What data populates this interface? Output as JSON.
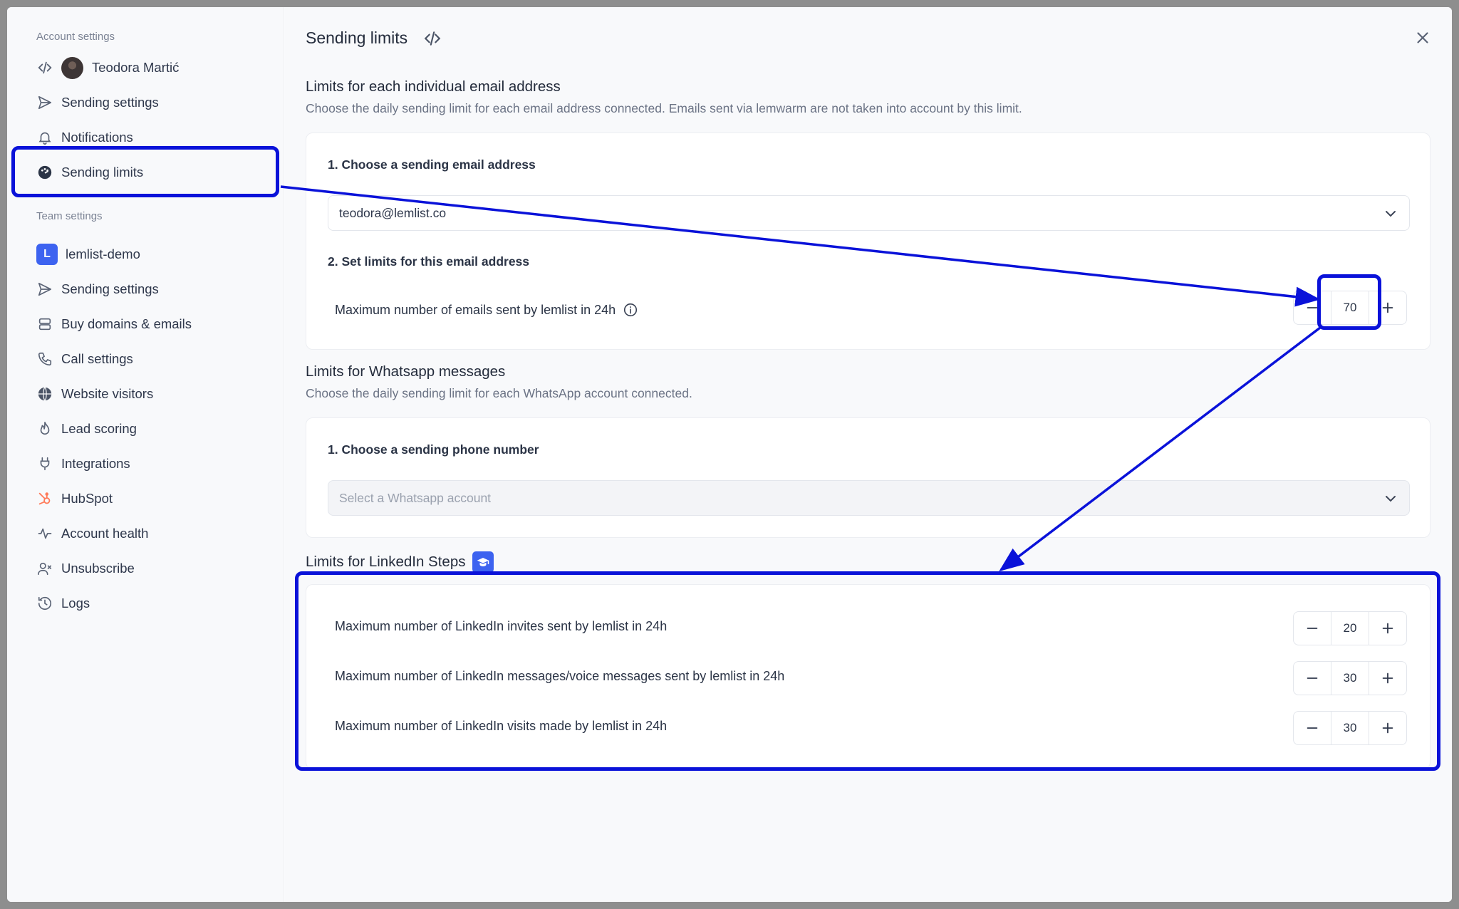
{
  "sidebar": {
    "account_heading": "Account settings",
    "team_heading": "Team settings",
    "account_items": [
      {
        "label": "Teodora Martić",
        "icon": "code-icon"
      },
      {
        "label": "Sending settings",
        "icon": "send-icon"
      },
      {
        "label": "Notifications",
        "icon": "bell-icon"
      },
      {
        "label": "Sending limits",
        "icon": "gauge-icon",
        "active": true
      }
    ],
    "team_items": [
      {
        "label": "lemlist-demo",
        "icon": "team-logo-icon"
      },
      {
        "label": "Sending settings",
        "icon": "send-icon"
      },
      {
        "label": "Buy domains & emails",
        "icon": "server-icon"
      },
      {
        "label": "Call settings",
        "icon": "phone-icon"
      },
      {
        "label": "Website visitors",
        "icon": "globe-icon"
      },
      {
        "label": "Lead scoring",
        "icon": "fire-icon"
      },
      {
        "label": "Integrations",
        "icon": "plug-icon"
      },
      {
        "label": "HubSpot",
        "icon": "hubspot-icon"
      },
      {
        "label": "Account health",
        "icon": "pulse-icon"
      },
      {
        "label": "Unsubscribe",
        "icon": "user-x-icon"
      },
      {
        "label": "Logs",
        "icon": "history-icon"
      }
    ],
    "team_logo_letter": "L"
  },
  "main": {
    "title": "Sending limits",
    "email_section": {
      "title": "Limits for each individual email address",
      "description": "Choose the daily sending limit for each email address connected. Emails sent via lemwarm are not taken into account by this limit.",
      "step1_label": "1. Choose a sending email address",
      "selected_email": "teodora@lemlist.co",
      "step2_label": "2. Set limits for this email address",
      "limit_label": "Maximum number of emails sent by lemlist in 24h",
      "limit_value": "70"
    },
    "whatsapp_section": {
      "title": "Limits for Whatsapp messages",
      "description": "Choose the daily sending limit for each WhatsApp account connected.",
      "step1_label": "1. Choose a sending phone number",
      "select_placeholder": "Select a Whatsapp account"
    },
    "linkedin_section": {
      "title": "Limits for LinkedIn Steps",
      "rows": [
        {
          "label": "Maximum number of LinkedIn invites sent by lemlist in 24h",
          "value": "20"
        },
        {
          "label": "Maximum number of LinkedIn messages/voice messages sent by lemlist in 24h",
          "value": "30"
        },
        {
          "label": "Maximum number of LinkedIn visits made by lemlist in 24h",
          "value": "30"
        }
      ]
    }
  },
  "colors": {
    "annotation": "#0a12d9",
    "accent": "#3d63f0"
  }
}
